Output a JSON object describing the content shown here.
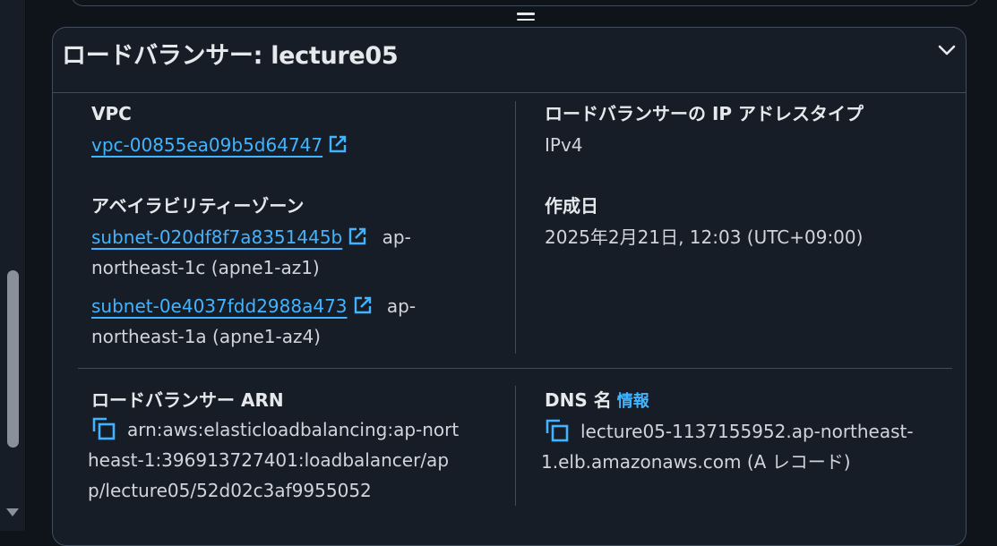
{
  "header": {
    "title": "ロードバランサー: lecture05"
  },
  "vpc": {
    "label": "VPC",
    "link": "vpc-00855ea09b5d64747"
  },
  "ip_type": {
    "label": "ロードバランサーの IP アドレスタイプ",
    "value": "IPv4"
  },
  "az": {
    "label": "アベイラビリティーゾーン",
    "subnets": [
      {
        "link": "subnet-020df8f7a8351445b",
        "suffix": "ap-",
        "line2": "northeast-1c (apne1-az1)"
      },
      {
        "link": "subnet-0e4037fdd2988a473",
        "suffix": "ap-",
        "line2": "northeast-1a (apne1-az4)"
      }
    ]
  },
  "created": {
    "label": "作成日",
    "value": "2025年2月21日, 12:03 (UTC+09:00)"
  },
  "arn": {
    "label": "ロードバランサー ARN",
    "line1": "arn:aws:elasticloadbalancing:ap-nort",
    "line2": "heast-1:396913727401:loadbalancer/ap",
    "line3": "p/lecture05/52d02c3af9955052"
  },
  "dns": {
    "label": "DNS 名",
    "info": "情報",
    "line1": "lecture05-1137155952.ap-northeast-",
    "line2": "1.elb.amazonaws.com (A レコード)"
  },
  "colors": {
    "background": "#0f141a",
    "panel": "#161d26",
    "border": "#414d5c",
    "link": "#42b4ff",
    "text": "#d1d5db",
    "heading": "#e6e9ec"
  }
}
